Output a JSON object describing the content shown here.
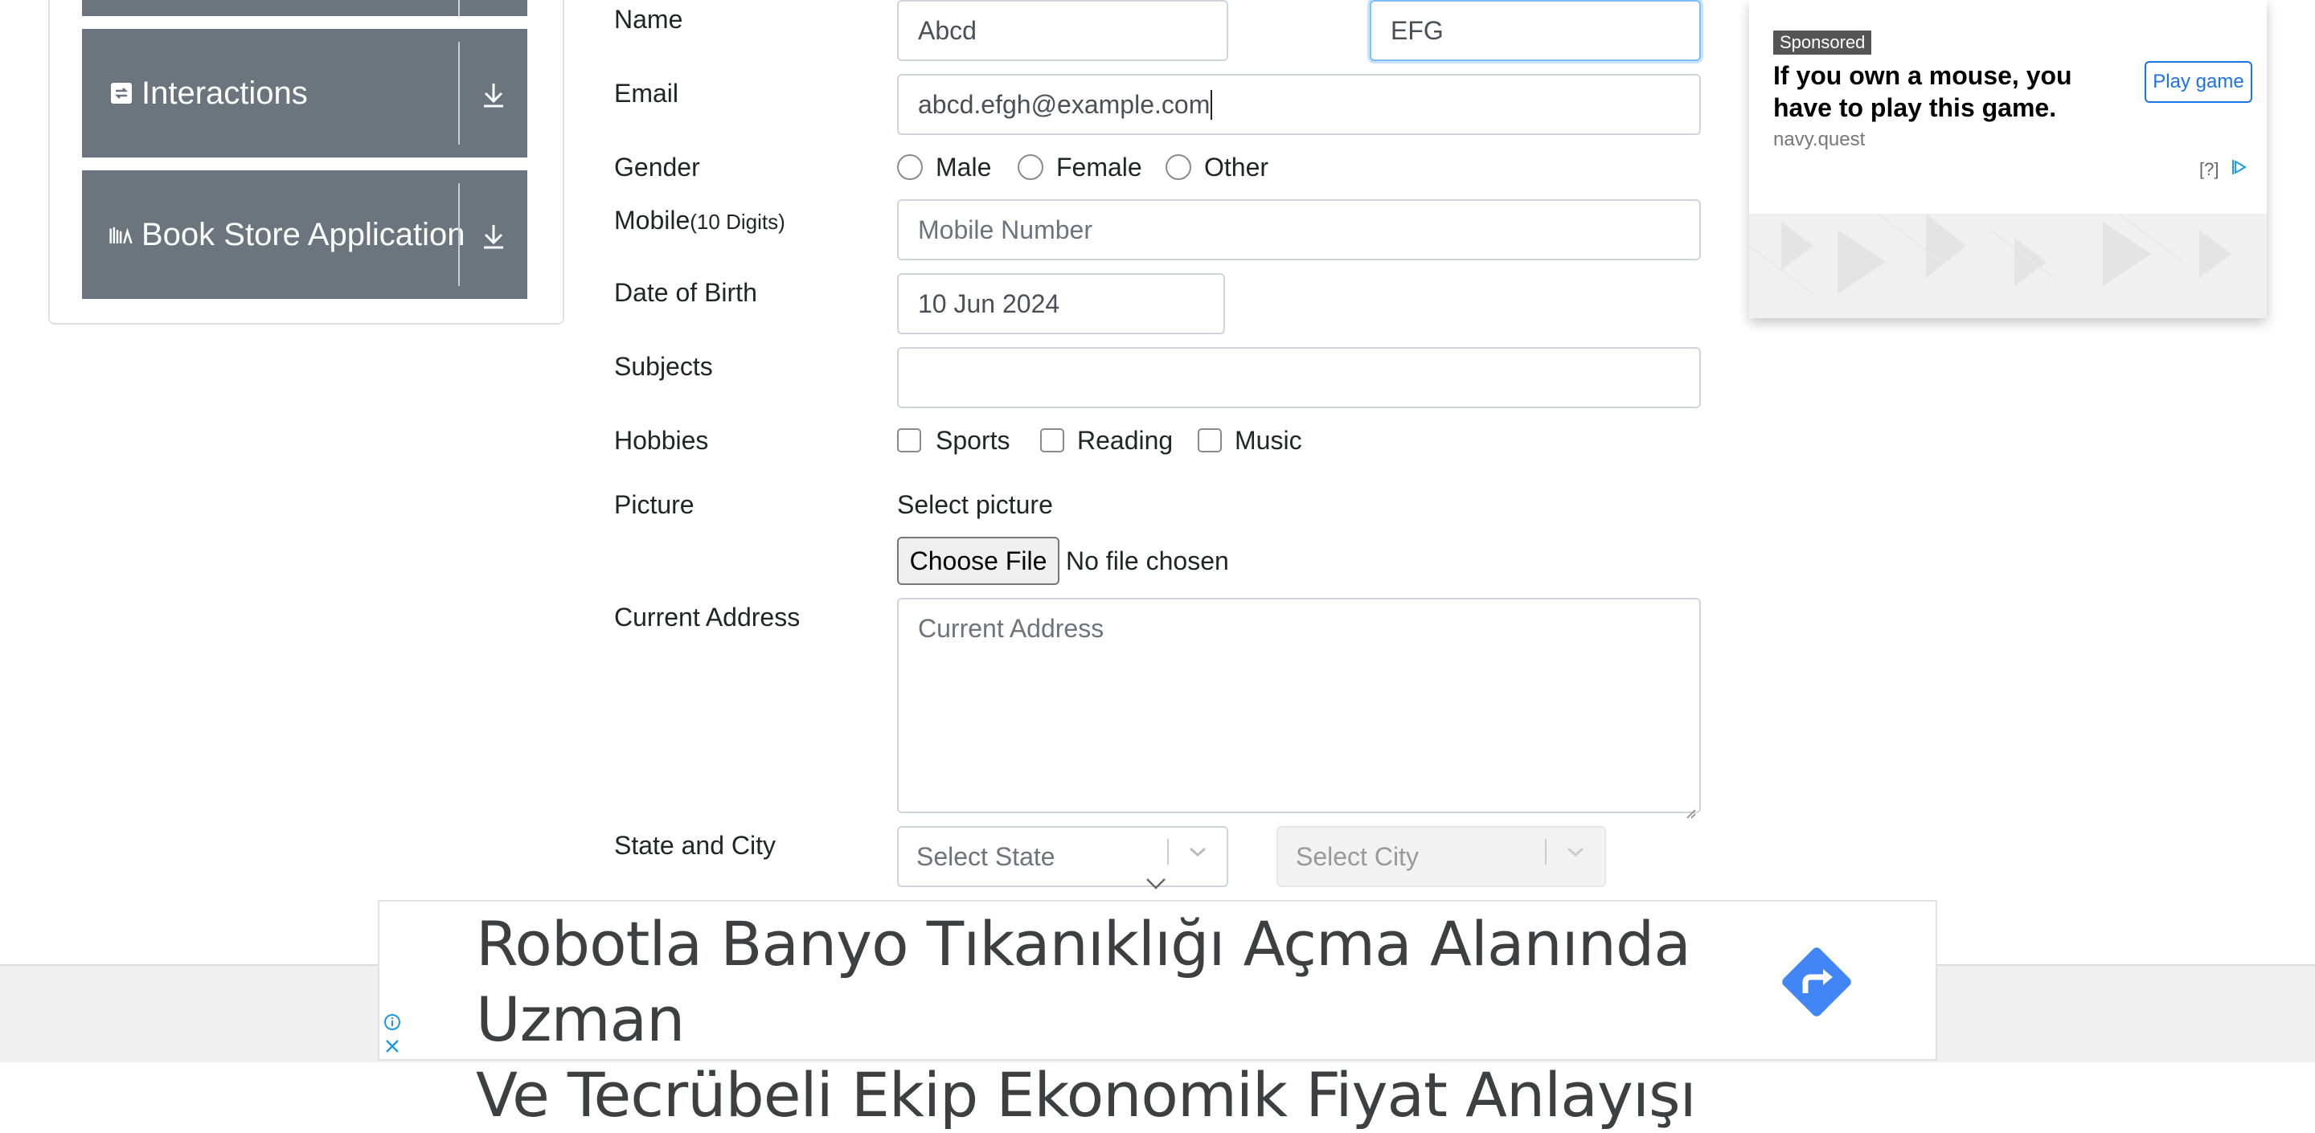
{
  "sidebar": {
    "items": [
      {
        "label": "Interactions",
        "icon": "interactions-icon"
      },
      {
        "label": "Book Store Application",
        "icon": "books-icon"
      }
    ]
  },
  "form": {
    "name_label": "Name",
    "first_name_value": "Abcd",
    "last_name_value": "EFG",
    "email_label": "Email",
    "email_value": "abcd.efgh@example.com",
    "gender_label": "Gender",
    "gender_options": [
      "Male",
      "Female",
      "Other"
    ],
    "mobile_label": "Mobile",
    "mobile_hint": "(10 Digits)",
    "mobile_placeholder": "Mobile Number",
    "dob_label": "Date of Birth",
    "dob_value": "10 Jun 2024",
    "subjects_label": "Subjects",
    "hobbies_label": "Hobbies",
    "hobby_options": [
      "Sports",
      "Reading",
      "Music"
    ],
    "picture_label": "Picture",
    "select_picture_text": "Select picture",
    "choose_file_label": "Choose File",
    "no_file_text": "No file chosen",
    "address_label": "Current Address",
    "address_placeholder": "Current Address",
    "state_city_label": "State and City",
    "state_placeholder": "Select State",
    "city_placeholder": "Select City"
  },
  "ad_right": {
    "sponsored": "Sponsored",
    "title": "If you own a mouse, you have to play this game.",
    "domain": "navy.quest",
    "button": "Play game",
    "help": "[?]"
  },
  "banner": {
    "line1": "Robotla Banyo Tıkanıklığı Açma Alanında Uzman",
    "line2": "Ve Tecrübeli Ekip Ekonomik Fiyat Anlayışı"
  },
  "colors": {
    "sidebar_bg": "#6c757d",
    "focus_border": "#80bdff",
    "ad_accent": "#1a73e8",
    "banner_arrow": "#4285f4"
  }
}
